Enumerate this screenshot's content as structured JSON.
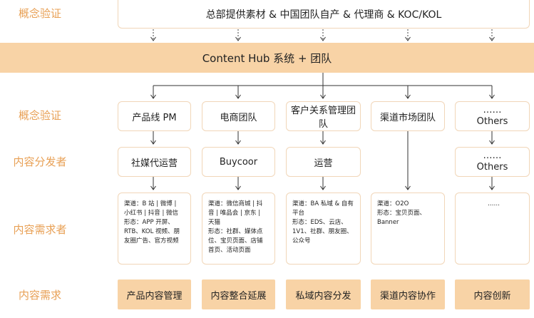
{
  "labels": {
    "concept_top": "概念验证",
    "concept": "概念验证",
    "distributor": "内容分发者",
    "demander": "内容需求者",
    "demand": "内容需求"
  },
  "top_box": "总部提供素材 & 中国团队自产 & 代理商 & KOC/KOL",
  "hub": "Content Hub 系统 + 团队",
  "columns": [
    {
      "team": "产品线 PM",
      "distributor": "社媒代运营",
      "detail": "渠道：B 站 | 微博 |\n小红书 | 抖音 | 微信\n形态：APP 开屏、\nRTB、KOL 视频、朋\n友圈广告、官方视频",
      "demand": "产品内容管理"
    },
    {
      "team": "电商团队",
      "distributor": "Buycoor",
      "detail": "渠道：微信商城 | 抖\n音 | 唯品会 | 京东 |\n天猫\n形态：社群、媒体点\n位、宝贝页面、店铺\n首页、活动页面",
      "demand": "内容整合延展"
    },
    {
      "team": "客户关系管理团队",
      "distributor": "运营",
      "detail": "渠道：BA 私域 & 自有\n平台\n形态：EDS、云店、\n1V1、社群、朋友圈、\n公众号",
      "demand": "私域内容分发"
    },
    {
      "team": "渠道市场团队",
      "distributor": "",
      "detail": "渠道：O2O\n形态：宝贝页面、\nBanner",
      "demand": "渠道内容协作"
    },
    {
      "team": "……\nOthers",
      "distributor": "……\nOthers",
      "detail": "……",
      "demand": "内容创新"
    }
  ]
}
